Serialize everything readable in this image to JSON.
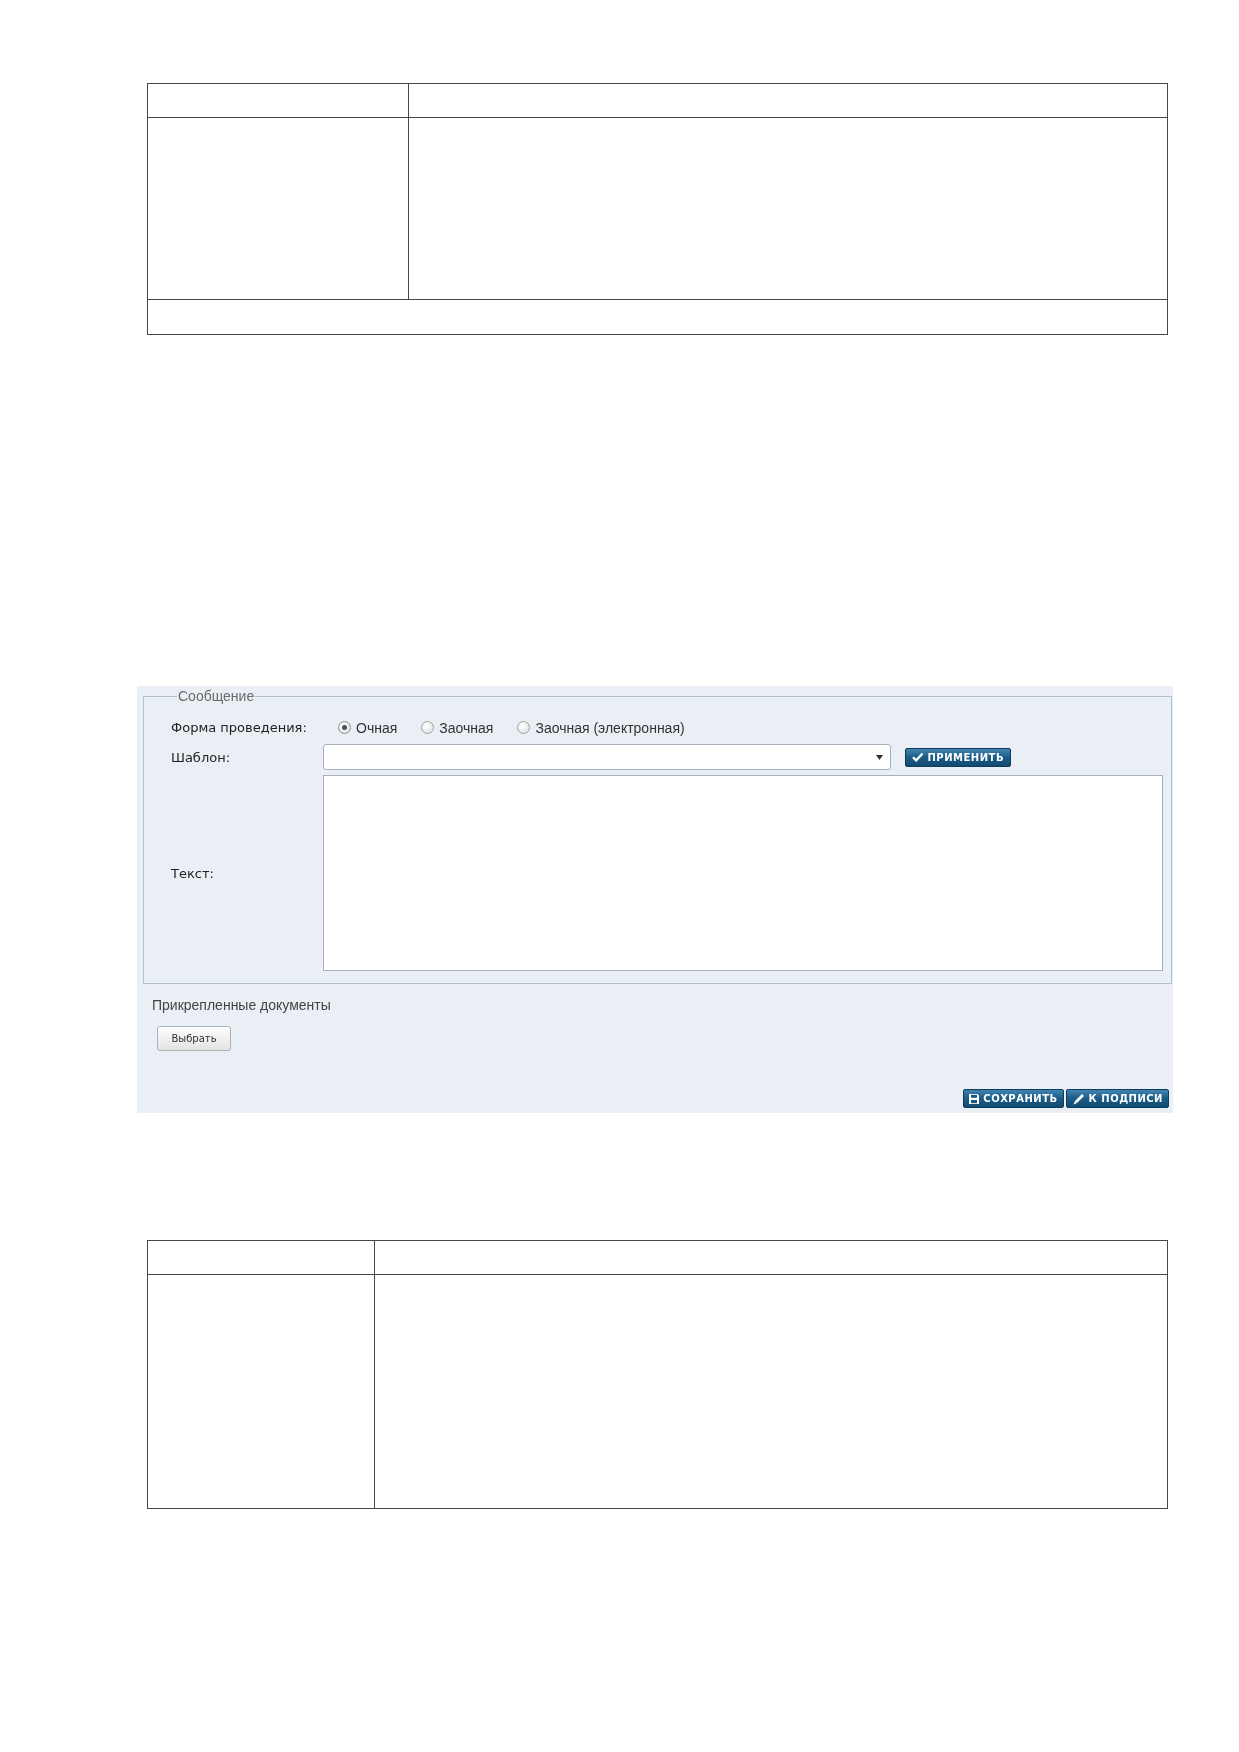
{
  "upper_table": {
    "rows": [
      {
        "kind": "split"
      },
      {
        "kind": "split"
      },
      {
        "kind": "full"
      }
    ]
  },
  "form": {
    "legend": "Сообщение",
    "fields": [
      {
        "kind": "radio",
        "label": "Форма проведения:",
        "options": [
          {
            "label": "Очная",
            "selected": true
          },
          {
            "label": "Заочная",
            "selected": false
          },
          {
            "label": "Заочная (электронная)",
            "selected": false
          }
        ]
      },
      {
        "kind": "select",
        "label": "Шаблон:",
        "button": "ПРИМЕНИТЬ"
      },
      {
        "kind": "textarea",
        "label": "Текст:"
      }
    ]
  },
  "attachments": {
    "title": "Прикрепленные документы",
    "button": "Выбрать"
  },
  "actions": [
    {
      "kind": "save",
      "label": "СОХРАНИТЬ"
    },
    {
      "kind": "sign",
      "label": "К ПОДПИСИ"
    }
  ],
  "lower_table": {
    "rows": [
      {
        "kind": "split"
      },
      {
        "kind": "split"
      }
    ]
  }
}
